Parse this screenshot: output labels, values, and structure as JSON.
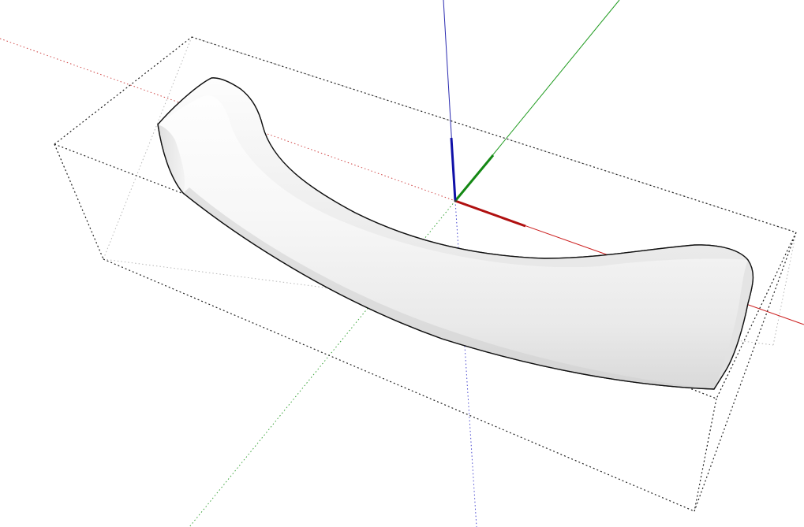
{
  "scene": {
    "background": "#ffffff",
    "model": {
      "name": "curved-handle-solid",
      "fill": "#f4f4f4",
      "edge": "#1a1a1a"
    },
    "bounding_box": {
      "color": "#222222",
      "style": "dotted"
    },
    "axes": {
      "red": "#cc1f1f",
      "green": "#1f9b1f",
      "blue": "#1f1fbf"
    }
  }
}
